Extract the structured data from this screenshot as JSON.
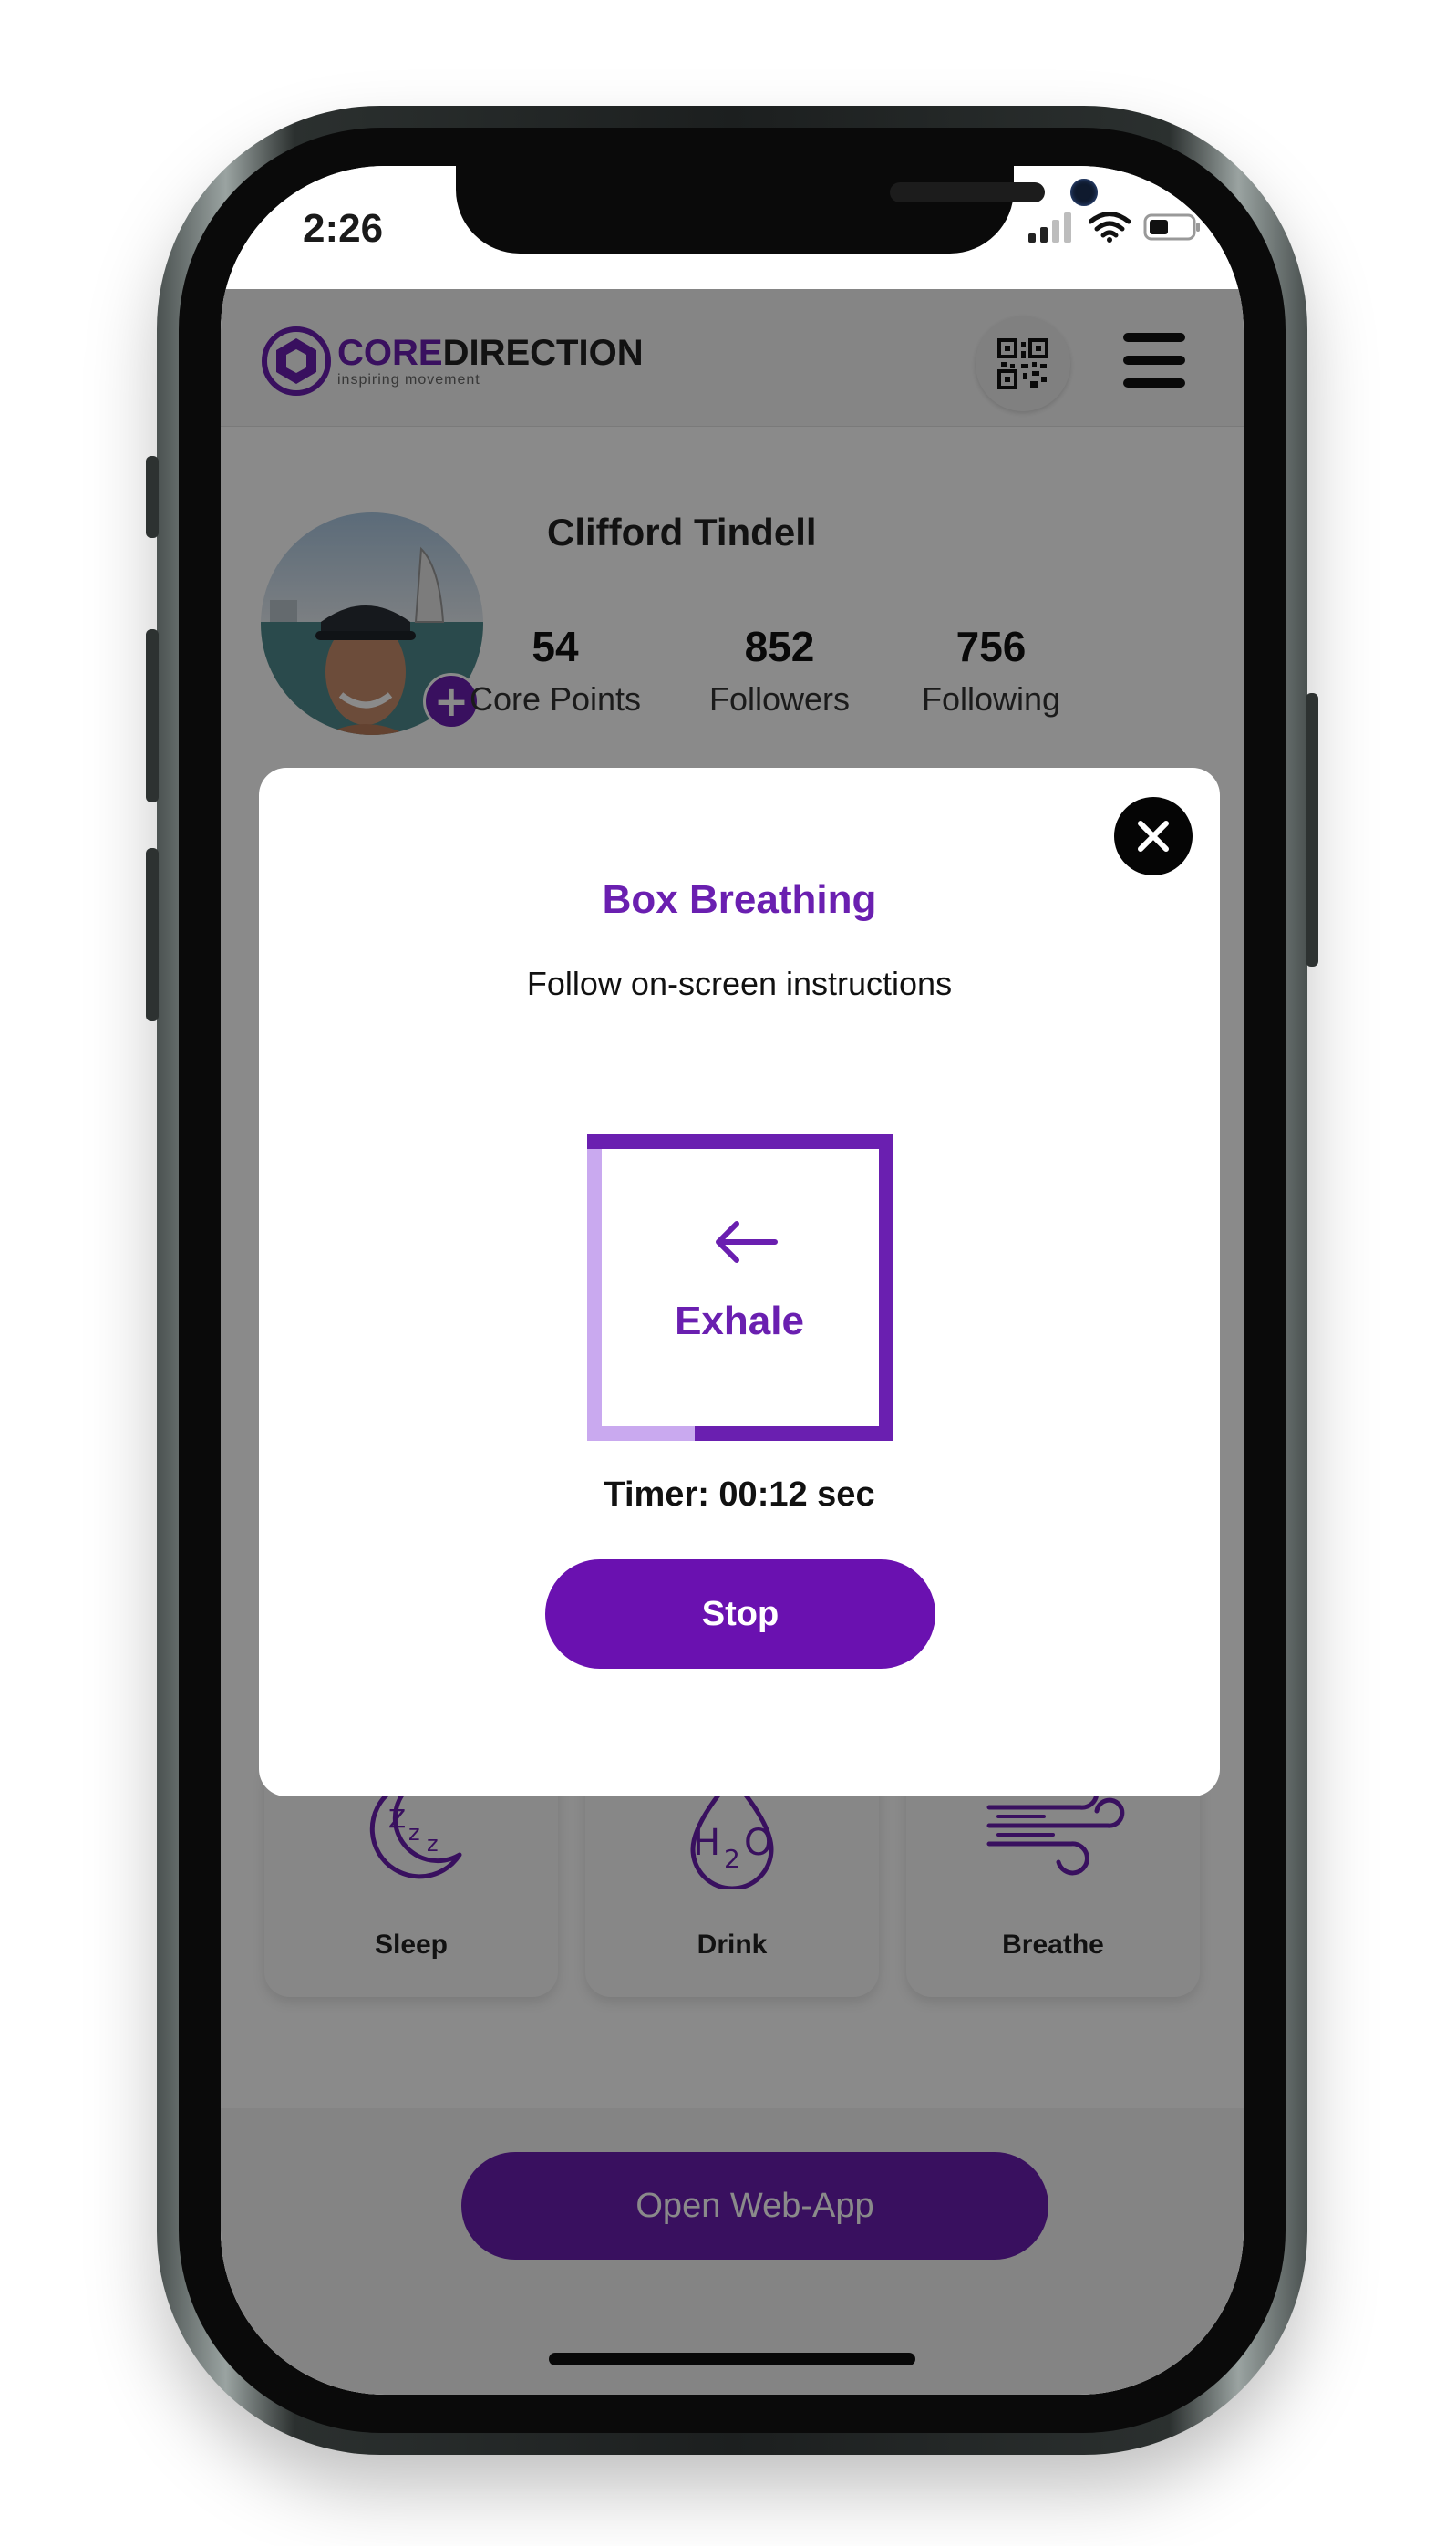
{
  "status_bar": {
    "time": "2:26"
  },
  "header": {
    "logo": {
      "core": "CORE",
      "direction": "DIRECTION",
      "tagline": "inspiring movement"
    }
  },
  "profile": {
    "name": "Clifford Tindell",
    "stats": [
      {
        "value": "54",
        "label": "Core Points"
      },
      {
        "value": "852",
        "label": "Followers"
      },
      {
        "value": "756",
        "label": "Following"
      }
    ],
    "add_symbol": "+"
  },
  "cards": [
    {
      "label": "Sleep",
      "icon": "sleep-icon"
    },
    {
      "label": "Drink",
      "icon": "water-drop-icon"
    },
    {
      "label": "Breathe",
      "icon": "wind-icon"
    }
  ],
  "web_app_button": "Open Web-App",
  "modal": {
    "title": "Box Breathing",
    "subtitle": "Follow on-screen instructions",
    "phase": "Exhale",
    "phase_icon": "arrow-left-icon",
    "timer": "Timer: 00:12 sec",
    "stop_label": "Stop"
  },
  "colors": {
    "accent": "#6a1fb0",
    "accent_light": "#c9a9ef",
    "overlay": "rgba(0,0,0,0.46)"
  }
}
